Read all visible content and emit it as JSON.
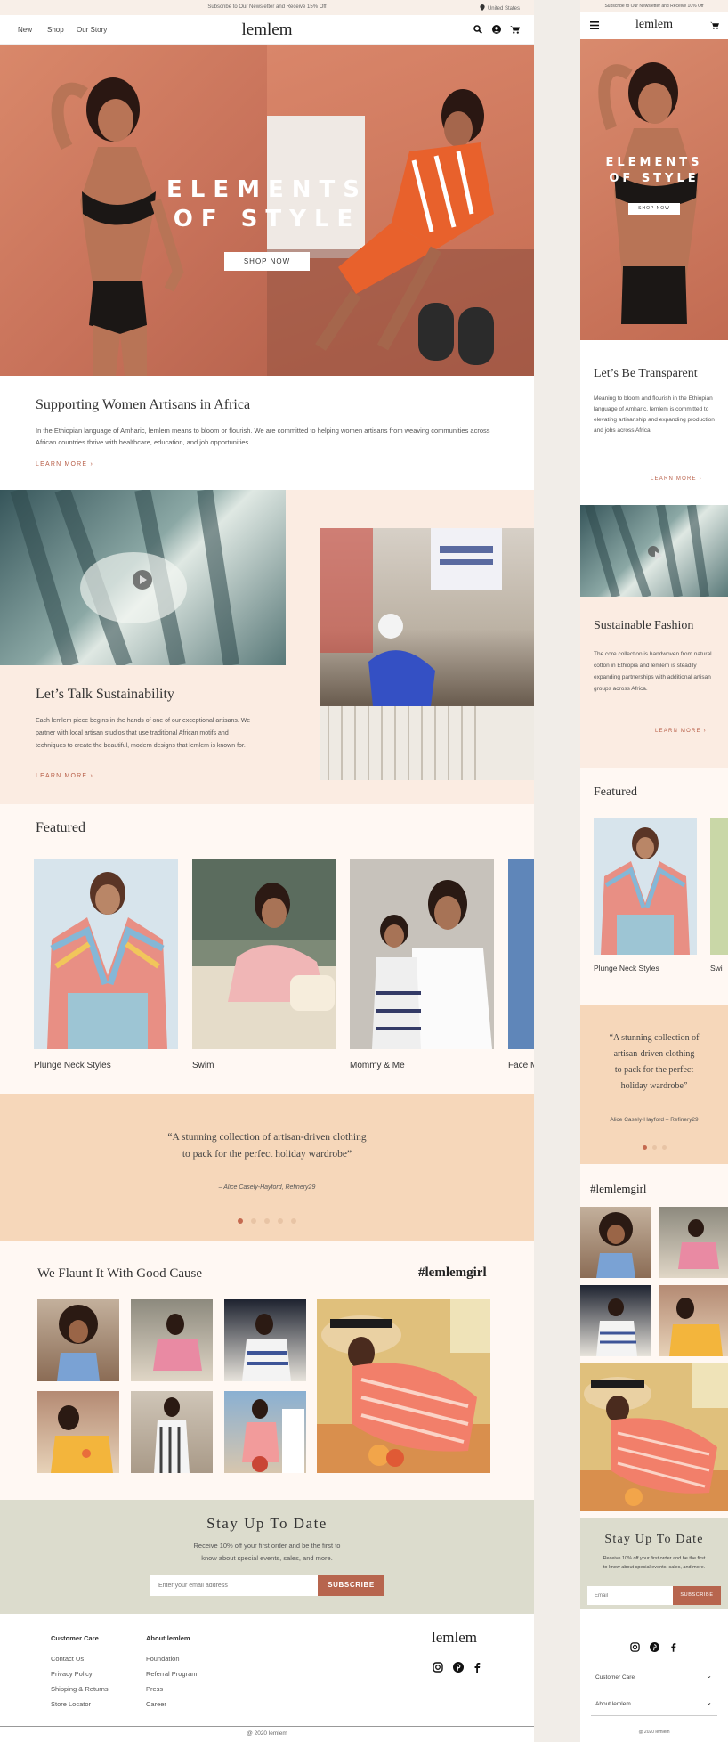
{
  "desktop": {
    "topbar": {
      "promo": "Subscribe to Our Newsletter and Receive 15% Off",
      "region": "United States"
    },
    "nav": {
      "links": [
        "New",
        "Shop",
        "Our Story"
      ],
      "logo": "lemlem",
      "icons": [
        "search-icon",
        "account-icon",
        "cart-icon"
      ]
    },
    "hero": {
      "title_line1": "ELEMENTS",
      "title_line2": "OF STYLE",
      "cta": "SHOP NOW"
    },
    "artisans": {
      "title": "Supporting Women Artisans in Africa",
      "body": "In the Ethiopian language of Amharic, lemlem means to bloom or flourish. We are committed to helping women artisans from weaving communities across African countries thrive with healthcare, education, and job opportunities.",
      "link": "LEARN MORE"
    },
    "sustain": {
      "title": "Let’s Talk Sustainability",
      "body": "Each lemlem piece begins in the hands of one of our exceptional artisans. We partner with local artisan studios that use traditional African motifs and techniques to create the beautiful, modern designs that lemlem is known for.",
      "link": "LEARN MORE"
    },
    "featured": {
      "title": "Featured",
      "cards": [
        {
          "label": "Plunge Neck Styles"
        },
        {
          "label": "Swim"
        },
        {
          "label": "Mommy & Me"
        },
        {
          "label": "Face M"
        }
      ]
    },
    "quote": {
      "line1": "“A stunning collection of artisan-driven clothing",
      "line2": "to pack for the perfect holiday wardrobe”",
      "attribution": "– Alice Casely-Hayford, Refinery29",
      "dots": 5,
      "active_dot": 0
    },
    "flaunt": {
      "title": "We Flaunt It With Good Cause",
      "hashtag": "#lemlemgirl"
    },
    "newsletter": {
      "title": "Stay Up To Date",
      "body1": "Receive 10% off your first order and be the first to",
      "body2": "know about special events, sales, and more.",
      "placeholder": "Enter your email address",
      "button": "SUBSCRIBE"
    },
    "footer": {
      "col1_title": "Customer Care",
      "col1_links": [
        "Contact Us",
        "Privacy Policy",
        "Shipping & Returns",
        "Store Locator"
      ],
      "col2_title": "About lemlem",
      "col2_links": [
        "Foundation",
        "Referral Program",
        "Press",
        "Career"
      ],
      "logo": "lemlem",
      "social": [
        "instagram-icon",
        "pinterest-icon",
        "facebook-icon"
      ],
      "copyright": "@ 2020 lemlem"
    }
  },
  "mobile": {
    "promo": "Subscribe to Our Newsletter and Receive 10% Off",
    "logo": "lemlem",
    "hero": {
      "title_line1": "ELEMENTS",
      "title_line2": "OF STYLE",
      "cta": "SHOP NOW"
    },
    "transparent": {
      "title": "Let’s Be Transparent",
      "body": "Meaning to bloom and flourish in the Ethiopian language of Amharic, lemlem is committed to elevating artisanship and expanding production and jobs across Africa.",
      "link": "LEARN MORE"
    },
    "sustainable": {
      "title": "Sustainable Fashion",
      "body": "The core collection is handwoven from natural cotton in Ethiopia and lemlem is steadily expanding partnerships with additional artisan groups across Africa.",
      "link": "LEARN MORE"
    },
    "featured": {
      "title": "Featured",
      "cards": [
        {
          "label": "Plunge Neck Styles"
        },
        {
          "label": "Swi"
        }
      ]
    },
    "quote": {
      "line1": "“A stunning collection of",
      "line2": "artisan-driven clothing",
      "line3": "to pack for the perfect",
      "line4": "holiday wardrobe”",
      "attribution": "Alice Casely-Hayford – Refinery29",
      "dots": 3,
      "active_dot": 0
    },
    "hashtag": "#lemlemgirl",
    "newsletter": {
      "title": "Stay Up To Date",
      "body1": "Receive 10% off your first order and be the first",
      "body2": "to know about special events, sales, and more.",
      "placeholder": "Email",
      "button": "SUBSCRIBE"
    },
    "footer": {
      "accordion": [
        "Customer Care",
        "About lemlem"
      ],
      "copyright": "@ 2020 lemlem"
    }
  },
  "colors": {
    "accent": "#b7654e",
    "peach": "#fbece2",
    "quote_bg": "#f6d7ba",
    "sage": "#dcdccd",
    "cream": "#fff8f3"
  }
}
